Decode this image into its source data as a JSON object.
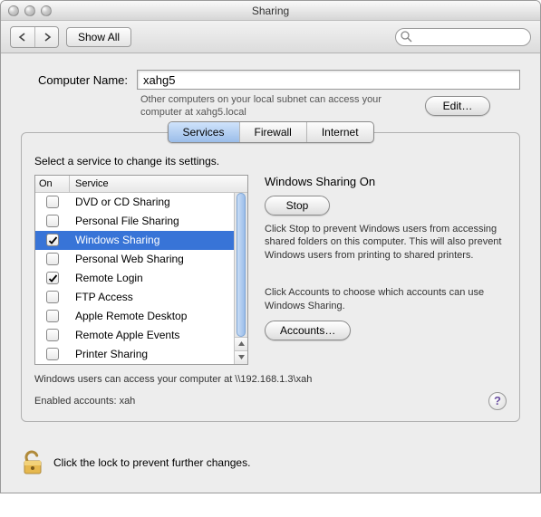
{
  "window": {
    "title": "Sharing"
  },
  "toolbar": {
    "show_all": "Show All",
    "search_placeholder": ""
  },
  "computer_name": {
    "label": "Computer Name:",
    "value": "xahg5",
    "subnet_note": "Other computers on your local subnet can access your computer at xahg5.local",
    "edit_btn": "Edit…"
  },
  "tabs": {
    "services": "Services",
    "firewall": "Firewall",
    "internet": "Internet"
  },
  "services_panel": {
    "instruction": "Select a service to change its settings.",
    "col_on": "On",
    "col_service": "Service",
    "items": [
      {
        "label": "DVD or CD Sharing",
        "on": false,
        "selected": false
      },
      {
        "label": "Personal File Sharing",
        "on": false,
        "selected": false
      },
      {
        "label": "Windows Sharing",
        "on": true,
        "selected": true
      },
      {
        "label": "Personal Web Sharing",
        "on": false,
        "selected": false
      },
      {
        "label": "Remote Login",
        "on": true,
        "selected": false
      },
      {
        "label": "FTP Access",
        "on": false,
        "selected": false
      },
      {
        "label": "Apple Remote Desktop",
        "on": false,
        "selected": false
      },
      {
        "label": "Remote Apple Events",
        "on": false,
        "selected": false
      },
      {
        "label": "Printer Sharing",
        "on": false,
        "selected": false
      }
    ],
    "detail": {
      "title": "Windows Sharing On",
      "stop_btn": "Stop",
      "stop_desc": "Click Stop to prevent Windows users from accessing shared folders on this computer. This will also prevent Windows users from printing to shared printers.",
      "accounts_desc": "Click Accounts to choose which accounts can use Windows Sharing.",
      "accounts_btn": "Accounts…"
    },
    "footer_access": "Windows users can access your computer at \\\\192.168.1.3\\xah",
    "footer_enabled": "Enabled accounts: xah"
  },
  "lock": {
    "text": "Click the lock to prevent further changes."
  },
  "help": {
    "glyph": "?"
  }
}
